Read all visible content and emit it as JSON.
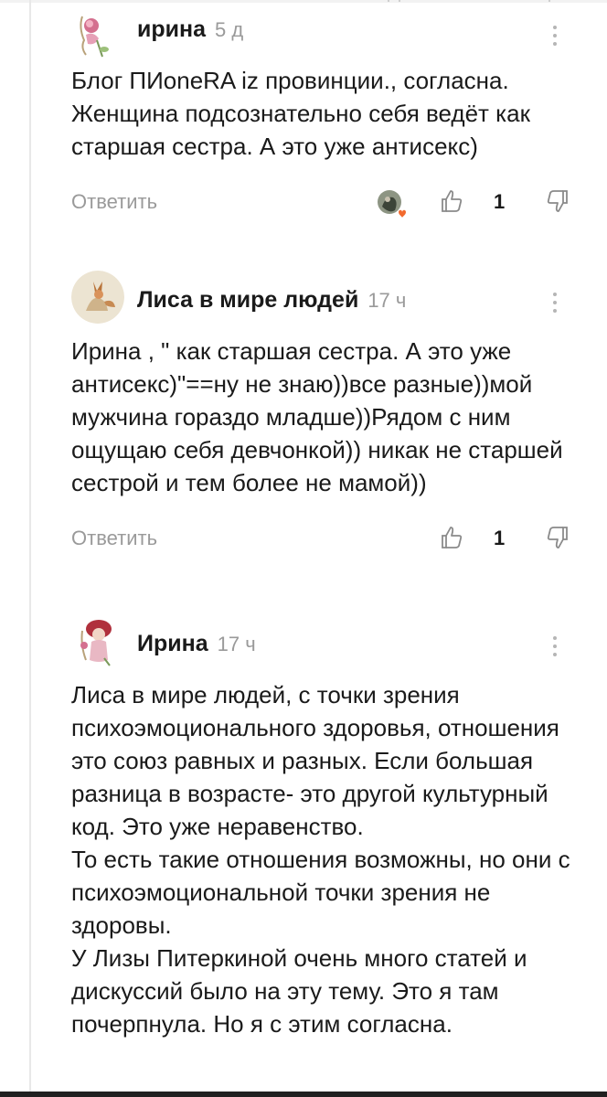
{
  "comments": [
    {
      "author": "ирина",
      "time": "5 д",
      "text": [
        "Блог ПИoneRA iz провинции., согласна. Женщина подсознательно себя ведёт как старшая сестра. А это уже антисекс)"
      ],
      "reply_label": "Ответить",
      "likes": "1",
      "has_reactor": true
    },
    {
      "author": "Лиса в мире людей",
      "time": "17 ч",
      "text": [
        "Ирина , \" как старшая сестра. А это уже антисекс)\"==ну не знаю))все разные))мой мужчина гораздо младше))Рядом с ним ощущаю себя девчонкой)) никак не старшей сестрой и тем более не мамой))"
      ],
      "reply_label": "Ответить",
      "likes": "1",
      "has_reactor": false
    },
    {
      "author": "Ирина",
      "time": "17 ч",
      "text": [
        "Лиса в мире людей, с точки зрения психоэмоционального здоровья, отношения это союз равных и разных. Если большая разница в возрасте- это другой культурный код. Это уже неравенство.",
        "То есть такие отношения возможны, но они с психоэмоциональной точки зрения не здоровы.",
        "У Лизы Питеркиной очень много статей и дискуссий было на эту тему. Это я там почерпнула. Но я с этим согласна."
      ]
    }
  ],
  "colors": {
    "text": "#1a1a1a",
    "muted": "#9a9a9a",
    "divider": "#e8e8e8",
    "heart": "#f26a2e"
  },
  "icons": {
    "like": "thumb-up-icon",
    "dislike": "thumb-down-icon",
    "menu": "more-vertical-icon"
  }
}
